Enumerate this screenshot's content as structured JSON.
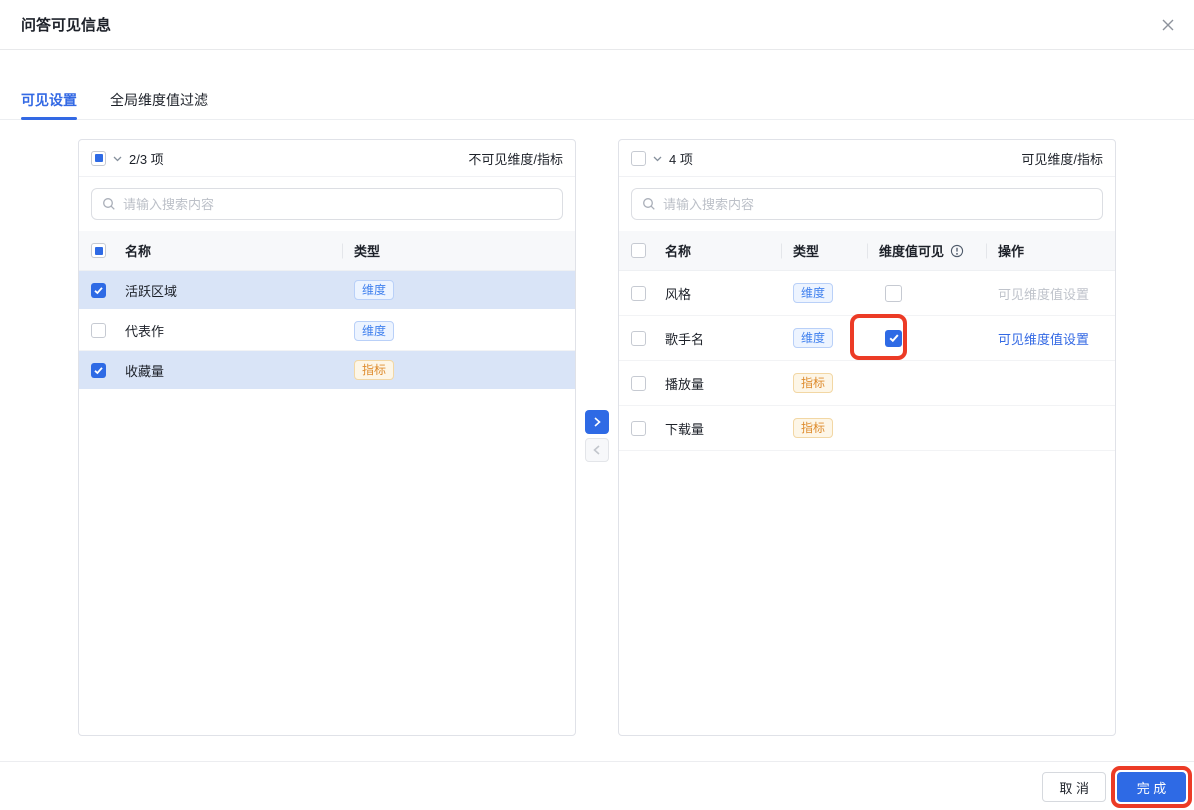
{
  "dialog": {
    "title": "问答可见信息"
  },
  "tabs": {
    "visible_settings": "可见设置",
    "global_dim_filter": "全局维度值过滤"
  },
  "left_panel": {
    "count": "2/3 项",
    "title": "不可见维度/指标",
    "search_placeholder": "请输入搜索内容",
    "columns": {
      "name": "名称",
      "type": "类型"
    },
    "rows": [
      {
        "name": "活跃区域",
        "type": "维度",
        "checked": true
      },
      {
        "name": "代表作",
        "type": "维度",
        "checked": false
      },
      {
        "name": "收藏量",
        "type": "指标",
        "checked": true
      }
    ]
  },
  "right_panel": {
    "count": "4 项",
    "title": "可见维度/指标",
    "search_placeholder": "请输入搜索内容",
    "columns": {
      "name": "名称",
      "type": "类型",
      "dim_visible": "维度值可见",
      "action": "操作"
    },
    "rows": [
      {
        "name": "风格",
        "type": "维度",
        "dim_visible_checked": false,
        "action": "可见维度值设置",
        "action_enabled": false
      },
      {
        "name": "歌手名",
        "type": "维度",
        "dim_visible_checked": true,
        "action": "可见维度值设置",
        "action_enabled": true,
        "annotated": true
      },
      {
        "name": "播放量",
        "type": "指标"
      },
      {
        "name": "下载量",
        "type": "指标"
      }
    ]
  },
  "footer": {
    "cancel": "取 消",
    "confirm": "完 成"
  },
  "colors": {
    "accent_blue": "#2e6ae5",
    "annotation_red": "#ec3b26",
    "selected_row_bg": "#d9e4f7",
    "dim_badge_text": "#4080ee",
    "metric_badge_text": "#de8c2e"
  }
}
